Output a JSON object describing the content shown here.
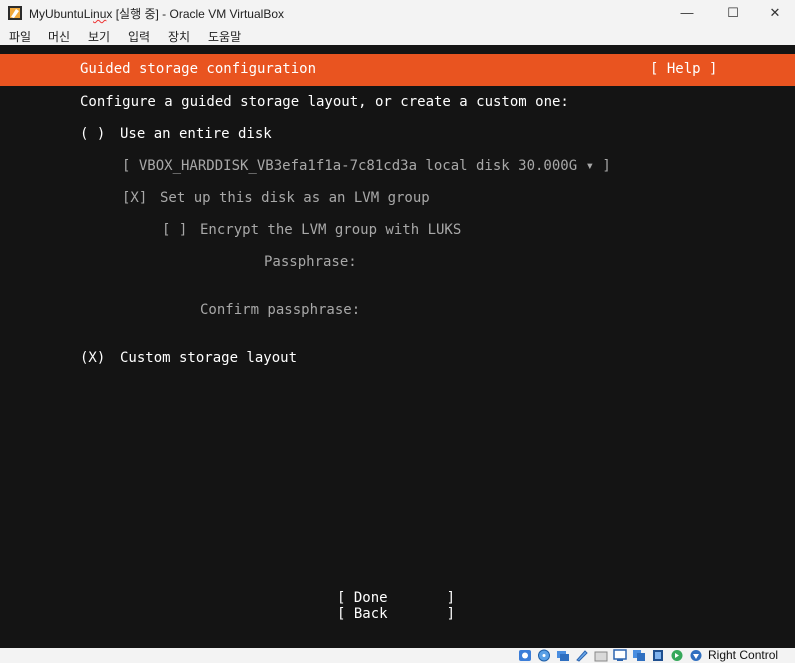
{
  "window": {
    "title_prefix": "MyUbuntuLi",
    "title_squiggle": "nu",
    "title_suffix": "x [실행 중] - Oracle VM VirtualBox",
    "minimize_glyph": "—",
    "maximize_glyph": "☐",
    "close_glyph": "✕"
  },
  "menu": {
    "items": [
      "파일",
      "머신",
      "보기",
      "입력",
      "장치",
      "도움말"
    ]
  },
  "installer": {
    "header_title": "Guided storage configuration",
    "help_label": "[ Help ]",
    "intro": "Configure a guided storage layout, or create a custom one:",
    "entire_disk_radio": "( )",
    "entire_disk_label": "Use an entire disk",
    "disk_select": "[ VBOX_HARDDISK_VB3efa1f1a-7c81cd3a local disk 30.000G ▾ ]",
    "lvm_checkbox": "[X]",
    "lvm_label": "Set up this disk as an LVM group",
    "encrypt_checkbox": "[ ]",
    "encrypt_label": "Encrypt the LVM group with LUKS",
    "passphrase_label": "Passphrase:",
    "confirm_label": "Confirm passphrase:",
    "custom_radio": "(X)",
    "custom_label": "Custom storage layout",
    "done_button": "[ Done       ]",
    "back_button": "[ Back       ]"
  },
  "statusbar": {
    "host_key_label": "Right Control",
    "icons": [
      "hard-disk-icon",
      "optical-drive-icon",
      "network-icon",
      "usb-icon",
      "shared-folders-icon",
      "display-icon",
      "recording-icon",
      "cpu-icon",
      "mouse-integration-icon",
      "keyboard-icon"
    ]
  },
  "colors": {
    "accent": "#e95420",
    "console_bg": "#141414",
    "dim_text": "#a8a8a8"
  }
}
